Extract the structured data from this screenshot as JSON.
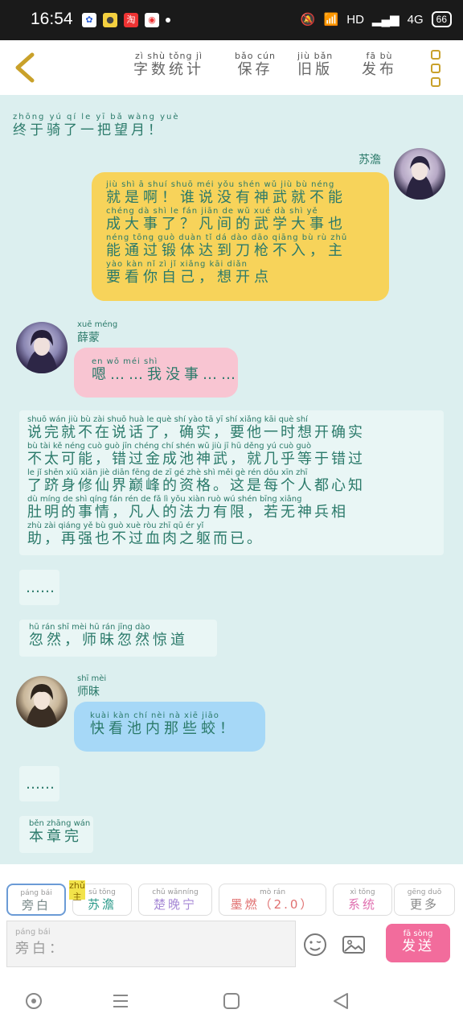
{
  "status": {
    "time": "16:54",
    "network": "HD",
    "signal": "4G",
    "battery": "66"
  },
  "topbar": {
    "menu": [
      {
        "py": "zì shù tǒng jì",
        "hz": "字数统计"
      },
      {
        "py": "bǎo cún",
        "hz": "保存"
      },
      {
        "py": "jiù bǎn",
        "hz": "旧版"
      },
      {
        "py": "fā bù",
        "hz": "发布"
      }
    ]
  },
  "messages": {
    "m0": {
      "py": "zhōng yú  qí  le  yī  bǎ wàng yuè",
      "hz": "终于骑了一把望月！"
    },
    "m1": {
      "name": "苏澹",
      "lines": [
        {
          "py": "jiù shì  ā       shuí shuō méi yǒu shén wǔ  jiù  bù néng",
          "hz": "就是啊！谁说没有神武就不能"
        },
        {
          "py": "chéng dà  shì  le      fán jiān  de  wǔ xué  dà  shì  yě",
          "hz": "成大事了？凡间的武学大事也"
        },
        {
          "py": "néng tōng guò duàn  tǐ   dá  dào dāo qiāng bù  rù      zhǔ",
          "hz": "能通过锻体达到刀枪不入，主"
        },
        {
          "py": "yào kàn  nǐ  zì  jǐ      xiǎng kāi diǎn",
          "hz": "要看你自己，想开点"
        }
      ]
    },
    "m2": {
      "name_py": "xuē méng",
      "name": "薛蒙",
      "py": "en       wǒ méi shì",
      "hz": "嗯……我没事……"
    },
    "m3": {
      "lines": [
        {
          "py": "shuō wán  jiù  bù  zài shuō huà  le      què shí     yào  tā   yī  shí xiǎng kāi què shí",
          "hz": "说完就不在说话了，确实，要他一时想开确实"
        },
        {
          "py": "bù  tài  kě néng    cuò guò jīn chéng chí shén wǔ    jiù  jī  hū děng yú cuò guò",
          "hz": "不太可能，错过金成池神武，就几乎等于错过"
        },
        {
          "py": "le  jǐ  shēn xiū xiān jiè diān fēng de  zī  gé    zhè shì měi gè rén dōu xīn zhī",
          "hz": "了跻身修仙界巅峰的资格。这是每个人都心知"
        },
        {
          "py": "dù míng de  shì qíng    fán rén  de  fǎ  lì yǒu xiàn   ruò wú shén bīng xiāng",
          "hz": "肚明的事情，凡人的法力有限，若无神兵相"
        },
        {
          "py": "zhù    zài qiáng yě  bù guò xuè ròu zhī qū  ér  yǐ",
          "hz": "助，再强也不过血肉之躯而已。"
        }
      ]
    },
    "m4": {
      "hz": "……"
    },
    "m5": {
      "py": "hū  rán      shī mèi hū  rán jīng dào",
      "hz": "忽然，师昧忽然惊道"
    },
    "m6": {
      "name_py": "shī mèi",
      "name": "师昧",
      "py": "kuài kàn chí  nèi  nà  xiē jiāo",
      "hz": "快看池内那些蛟！"
    },
    "m7": {
      "hz": "……"
    },
    "m8": {
      "py": "běn zhāng wán",
      "hz": "本章完"
    }
  },
  "roles": [
    {
      "py": "páng bái",
      "hz": "旁白",
      "color": "#7a8a8a"
    },
    {
      "py": "sū  tǒng",
      "hz": "苏澹",
      "color": "#2b9a8a",
      "badge": "zhǔ 主"
    },
    {
      "py": "chǔ wǎnníng",
      "hz": "楚晚宁",
      "color": "#a78ad6"
    },
    {
      "py": "mò  rán",
      "hz": "墨燃（2.0）",
      "color": "#e07070"
    },
    {
      "py": "xì tǒng",
      "hz": "系统",
      "color": "#e070b0"
    },
    {
      "py": "gēng duō",
      "hz": "更多",
      "color": "#888888"
    }
  ],
  "input": {
    "py": "páng bái",
    "hz": "旁白："
  },
  "send": {
    "py": "fā sòng",
    "hz": "发送"
  }
}
